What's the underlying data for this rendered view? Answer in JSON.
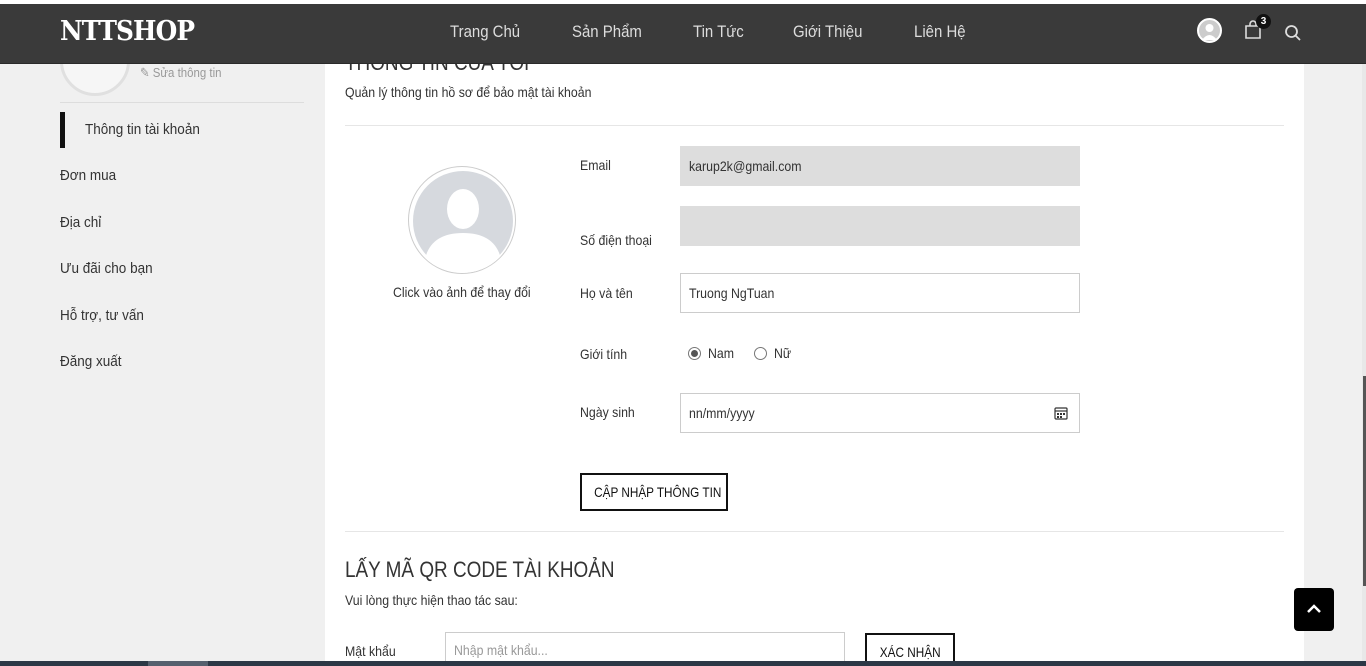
{
  "header": {
    "logo": "NTTSHOP",
    "nav": [
      "Trang Chủ",
      "Sản Phẩm",
      "Tin Tức",
      "Giới Thiệu",
      "Liên Hệ"
    ],
    "cart_count": "3"
  },
  "sidebar": {
    "edit_label": "Sửa thông tin",
    "items": [
      "Thông tin tài khoản",
      "Đơn mua",
      "Địa chỉ",
      "Ưu đãi cho bạn",
      "Hỗ trợ, tư vấn",
      "Đăng xuất"
    ],
    "active_index": 0
  },
  "profile": {
    "title": "THÔNG TIN CỦA TÔI",
    "subtitle": "Quản lý thông tin hồ sơ để bảo mật tài khoản",
    "avatar_hint": "Click vào ảnh để thay đổi",
    "email_label": "Email",
    "email_value": "karup2k@gmail.com",
    "phone_label": "Số điện thoại",
    "phone_value": "",
    "name_label": "Họ và tên",
    "name_value": "Truong NgTuan",
    "gender_label": "Giới tính",
    "gender_options": [
      "Nam",
      "Nữ"
    ],
    "gender_selected": "Nam",
    "dob_label": "Ngày sinh",
    "dob_placeholder": "nn/mm/yyyy",
    "update_button": "CẬP NHẬP THÔNG TIN"
  },
  "qr": {
    "title": "LẤY MÃ QR CODE TÀI KHOẢN",
    "subtitle": "Vui lòng thực hiện thao tác sau:",
    "password_label": "Mật khẩu",
    "password_placeholder": "Nhập mật khẩu...",
    "confirm_button": "XÁC NHẬN"
  },
  "colors": {
    "header_bg": "#3a3a3a",
    "page_bg": "#f0f0f0",
    "panel_bg": "#ffffff",
    "disabled_input": "#dddddd",
    "accent": "#111111"
  },
  "icons": [
    "user-icon",
    "cart-icon",
    "search-icon",
    "edit-icon",
    "calendar-icon",
    "chevron-up-icon"
  ]
}
